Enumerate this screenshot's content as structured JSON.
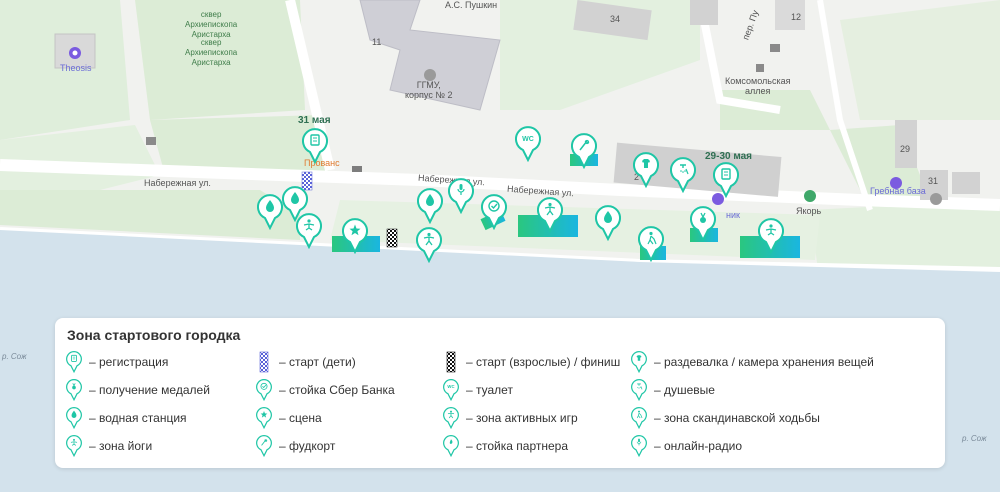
{
  "map": {
    "labels": {
      "square_name_1": "сквер\nАрхиепископа\nАристарха",
      "square_name_2": "сквер\nАрхиепископа\nАристарха",
      "theosis": "Theosis",
      "pushkin": "А.С. Пушкин",
      "gsmu": "ГГМУ,\nкорпус № 2",
      "building_11": "11",
      "building_34": "34",
      "building_12": "12",
      "street_per": "пер. Пу",
      "komsomol_alley": "Комсомольская\nаллея",
      "provence": "Прованс",
      "embankment_1": "Набережная ул.",
      "embankment_2": "Набережная ул.",
      "embankment_3": "Набережная ул.",
      "building_2": "2",
      "building_29": "29",
      "building_31": "31",
      "rowing_base": "Гребная база",
      "yakor": "Якорь",
      "gym": "ник",
      "water_left": "р. Сож",
      "water_right": "р. Сож",
      "date_31": "31 мая",
      "date_29_30": "29-30 мая"
    },
    "colors": {
      "teal": "#1fc6a6",
      "teal_dark": "#13a889",
      "water": "#d3e2ec",
      "park": "#dfeedb",
      "road": "#ffffff",
      "building": "#cfcfcf"
    }
  },
  "legend": {
    "title": "Зона стартового городка",
    "items": [
      {
        "icon": "registration-icon",
        "label": "– регистрация"
      },
      {
        "icon": "start-kids-icon",
        "label": "– старт (дети)"
      },
      {
        "icon": "start-adults-finish-icon",
        "label": "– старт (взрослые) / финиш"
      },
      {
        "icon": "changing-room-icon",
        "label": "– раздевалка / камера хранения вещей"
      },
      {
        "icon": "medal-icon",
        "label": "– получение медалей"
      },
      {
        "icon": "sber-bank-stand-icon",
        "label": "– стойка Сбер Банка"
      },
      {
        "icon": "toilet-icon",
        "label": "– туалет"
      },
      {
        "icon": "shower-icon",
        "label": "– душевые"
      },
      {
        "icon": "water-station-icon",
        "label": "– водная станция"
      },
      {
        "icon": "stage-icon",
        "label": "– сцена"
      },
      {
        "icon": "active-games-icon",
        "label": "– зона активных игр"
      },
      {
        "icon": "nordic-walking-icon",
        "label": "– зона скандинавской ходьбы"
      },
      {
        "icon": "yoga-icon",
        "label": "– зона йоги"
      },
      {
        "icon": "food-court-icon",
        "label": "– фудкорт"
      },
      {
        "icon": "partner-stand-icon",
        "label": "– стойка партнера"
      },
      {
        "icon": "online-radio-icon",
        "label": "– онлайн-радио"
      }
    ],
    "toilet_icon_text": "WC"
  }
}
